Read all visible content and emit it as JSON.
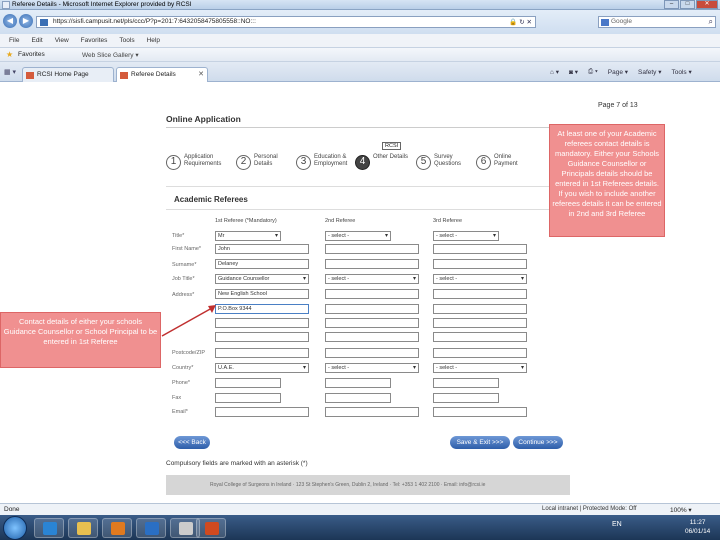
{
  "window": {
    "title": "Referee Details - Microsoft Internet Explorer provided by RCSI",
    "min": "–",
    "max": "□",
    "close": "✕"
  },
  "address_bar": {
    "url": "https://sisfi.campusit.net/pls/ccc/P?p=201:7:6432058475805558::NO:::",
    "controls": "🔒 ↻ ✕",
    "search_placeholder": "Google"
  },
  "menu": [
    "File",
    "Edit",
    "View",
    "Favorites",
    "Tools",
    "Help"
  ],
  "favorites_bar": {
    "label": "Favorites",
    "web_slice": "Web Slice Gallery ▾"
  },
  "tabs": [
    {
      "label": "RCSI Home Page"
    },
    {
      "label": "Referee Details"
    }
  ],
  "command_bar": [
    "Page ▾",
    "Safety ▾",
    "Tools ▾"
  ],
  "page": {
    "page_label": "Page 7 of 13",
    "title": "Online Application",
    "rcsi_tag": "RCSI",
    "steps": [
      {
        "num": "1",
        "label": "Application Requirements"
      },
      {
        "num": "2",
        "label": "Personal Details"
      },
      {
        "num": "3",
        "label": "Education & Employment"
      },
      {
        "num": "4",
        "label": "Other Details"
      },
      {
        "num": "5",
        "label": "Survey Questions"
      },
      {
        "num": "6",
        "label": "Online Payment"
      }
    ],
    "form_heading": "Academic Referees",
    "col_headers": [
      "1st Referee (*Mandatory)",
      "2nd Referee",
      "3rd Referee"
    ],
    "row_labels": {
      "title": "Title*",
      "first_name": "First Name*",
      "surname": "Surname*",
      "job_title": "Job Title*",
      "address": "Address*",
      "postcode": "Postcode/ZIP",
      "country": "Country*",
      "phone": "Phone*",
      "fax": "Fax",
      "email": "Email*"
    },
    "ref1": {
      "title": "Mr",
      "first_name": "John",
      "surname": "Delaney",
      "job_title": "Guidance Counsellor",
      "address1": "New English School",
      "address2": "P.O.Box 9344",
      "country": "U.A.E."
    },
    "ref2": {
      "title": "- select -",
      "job_title": "- select -",
      "country": "- select -"
    },
    "ref3": {
      "title": "- select -",
      "job_title": "- select -",
      "country": "- select -"
    },
    "back_button": "<<< Back",
    "save_button": "Save & Exit >>>",
    "continue_button": "Continue >>>",
    "compulsory_note": "Compulsory fields are marked with an asterisk (*)",
    "footer": "Royal College of Surgeons in Ireland · 123 St Stephen's Green, Dublin 2, Ireland · Tel: +353 1 402 2100 · Email: info@rcsi.ie"
  },
  "callouts": {
    "right": "At least one of your Academic referees contact details is mandatory. Either your Schools Guidance Counsellor or Principals details should be entered in 1st Referees details. If you wish to include another referees details it can be entered in 2nd and 3rd Referee",
    "left": "Contact details of either your schools Guidance Counsellor or School Principal to be entered in 1st Referee"
  },
  "status_bar": {
    "left": "Done",
    "zone": "Local intranet | Protected Mode: Off",
    "zoom": "100% ▾"
  },
  "taskbar": {
    "tray": "EN",
    "time": "11:27",
    "date": "06/01/14"
  },
  "colors": {
    "callout": "#f09090",
    "button": "#2e5ea9",
    "taskbar": "#1c3656"
  }
}
